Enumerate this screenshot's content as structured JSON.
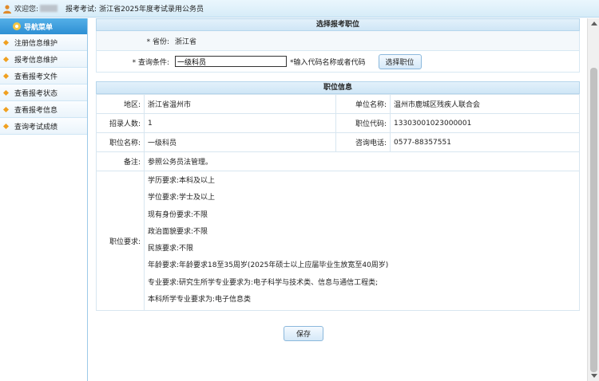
{
  "topbar": {
    "welcome": "欢迎您:",
    "exam_prefix": "报考考试:",
    "exam_name": "浙江省2025年度考试录用公务员"
  },
  "sidebar": {
    "header": "导航菜单",
    "items": [
      {
        "label": "注册信息维护"
      },
      {
        "label": "报考信息维护"
      },
      {
        "label": "查看报考文件"
      },
      {
        "label": "查看报考状态"
      },
      {
        "label": "查看报考信息"
      },
      {
        "label": "查询考试成绩"
      }
    ]
  },
  "select_section": {
    "title": "选择报考职位",
    "province_label": "* 省份:",
    "province_value": "浙江省",
    "query_label": "* 查询条件:",
    "query_value": "一级科员",
    "hint": "*输入代码名称或者代码",
    "select_button": "选择职位"
  },
  "info_section": {
    "title": "职位信息",
    "region_label": "地区:",
    "region_value": "浙江省温州市",
    "unit_label": "单位名称:",
    "unit_value": "温州市鹿城区残疾人联合会",
    "count_label": "招录人数:",
    "count_value": "1",
    "code_label": "职位代码:",
    "code_value": "13303001023000001",
    "position_label": "职位名称:",
    "position_value": "一级科员",
    "phone_label": "咨询电话:",
    "phone_value": "0577-88357551",
    "remark_label": "备注:",
    "remark_value": "参照公务员法管理。",
    "req_label": "职位要求:",
    "requirements": [
      "学历要求:本科及以上",
      "学位要求:学士及以上",
      "现有身份要求:不限",
      "政治面貌要求:不限",
      "民族要求:不限",
      "年龄要求:年龄要求18至35周岁(2025年硕士以上应届毕业生放宽至40周岁)",
      "专业要求:研究生所学专业要求为:电子科学与技术类、信息与通信工程类;",
      "本科所学专业要求为:电子信息类"
    ]
  },
  "save_button": "保存",
  "colors": {
    "nav_header": "#3a9ddf",
    "section_header": "#d6ebf8",
    "bullet": "#f0a020"
  }
}
